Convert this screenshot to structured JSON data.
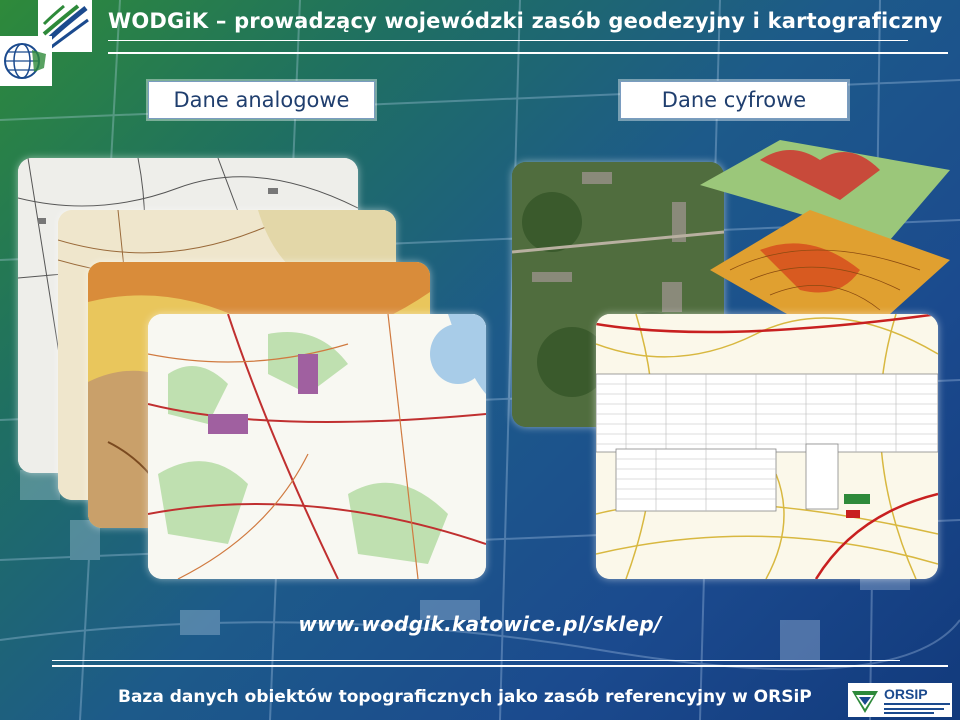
{
  "header": {
    "title": "WODGiK – prowadzący wojewódzki zasób geodezyjny i kartograficzny"
  },
  "sections": {
    "analog_label": "Dane analogowe",
    "digital_label": "Dane cyfrowe"
  },
  "link": {
    "url": "www.wodgik.katowice.pl/sklep/"
  },
  "footer": {
    "text": "Baza danych obiektów topograficznych jako zasób referencyjny  w ORSiP",
    "logo_text": "ORSIP"
  },
  "colors": {
    "title": "#ffffff",
    "label_text": "#1f3e6e",
    "accent_green": "#2e8a3a",
    "accent_blue": "#1b4a8e"
  }
}
